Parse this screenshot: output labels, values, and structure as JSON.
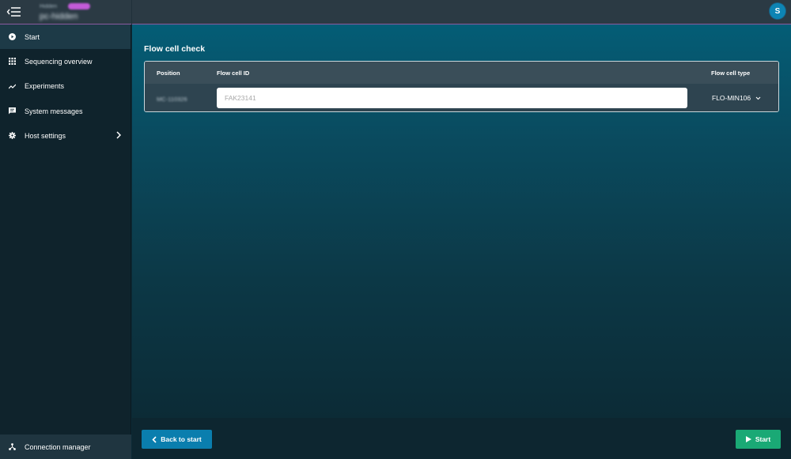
{
  "topbar": {
    "host_small": "Hidden",
    "host_name": "pc-hidden",
    "avatar_initial": "S",
    "menu_icon": "menu-collapse-icon"
  },
  "sidebar": {
    "items": [
      {
        "label": "Start",
        "icon": "play-circle-icon",
        "active": true
      },
      {
        "label": "Sequencing overview",
        "icon": "grid-icon"
      },
      {
        "label": "Experiments",
        "icon": "trend-icon"
      },
      {
        "label": "System messages",
        "icon": "message-icon"
      },
      {
        "label": "Host settings",
        "icon": "gear-icon",
        "expandable": true
      }
    ],
    "connection_manager": "Connection manager"
  },
  "main": {
    "title": "Flow cell check",
    "table": {
      "headers": {
        "position": "Position",
        "flow_cell_id": "Flow cell ID",
        "flow_cell_type": "Flow cell type"
      },
      "row": {
        "position": "MC-110326",
        "flow_cell_id_value": "",
        "flow_cell_id_placeholder": "FAK23141",
        "flow_cell_type": "FLO-MIN106"
      }
    }
  },
  "footer": {
    "back_label": "Back to start",
    "start_label": "Start"
  },
  "colors": {
    "accent": "#0a7eae",
    "start_green": "#1aa975",
    "badge": "#c35bd8"
  }
}
